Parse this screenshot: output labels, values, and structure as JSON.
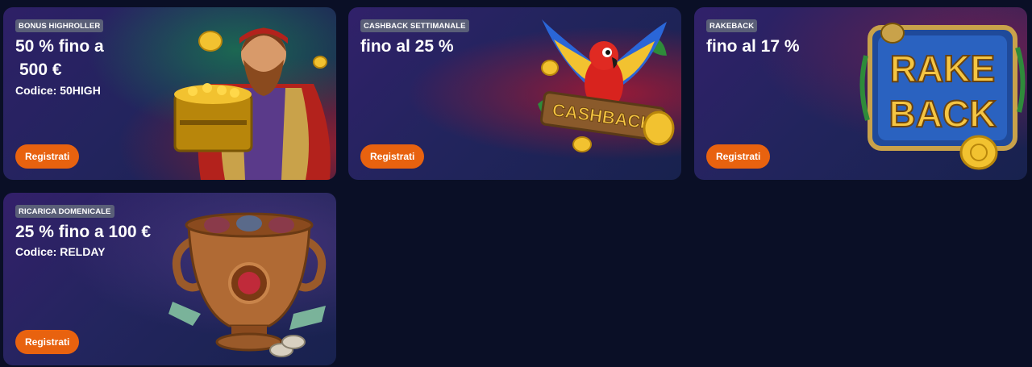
{
  "cards": [
    {
      "badge": "BONUS HIGHROLLER",
      "headline_line1": "50 % fino a",
      "headline_line2": "500 €",
      "code": "Codice: 50HIGH",
      "button": "Registrati",
      "illustration": "viking-gold-chest-illustration"
    },
    {
      "badge": "CASHBACK SETTIMANALE",
      "headline_line1": "fino al 25 %",
      "button": "Registrati",
      "illustration": "parrot-cashback-sign-illustration",
      "illustration_text": "CASHBACK"
    },
    {
      "badge": "RAKEBACK",
      "headline_line1": "fino al 17 %",
      "button": "Registrati",
      "illustration": "rake-back-logo-illustration",
      "illustration_text_1": "RAKE",
      "illustration_text_2": "BACK"
    },
    {
      "badge": "RICARICA DOMENICALE",
      "headline_line1": "25 % fino a 100 €",
      "code": "Codice: RELDAY",
      "button": "Registrati",
      "illustration": "bronze-urn-illustration"
    }
  ],
  "colors": {
    "page_bg": "#0a0f26",
    "button_bg": "#e8620f",
    "badge_bg": "#5a5f78",
    "gold": "#f2c230"
  }
}
